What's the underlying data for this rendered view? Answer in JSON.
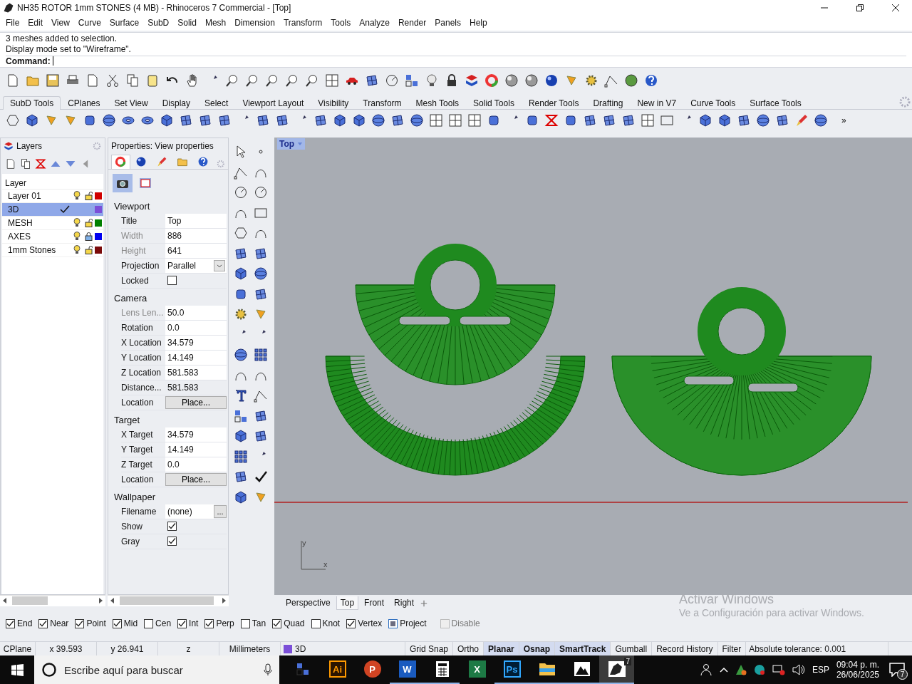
{
  "window": {
    "title": "NH35 ROTOR 1mm STONES (4 MB) - Rhinoceros 7 Commercial - [Top]"
  },
  "menu": [
    "File",
    "Edit",
    "View",
    "Curve",
    "Surface",
    "SubD",
    "Solid",
    "Mesh",
    "Dimension",
    "Transform",
    "Tools",
    "Analyze",
    "Render",
    "Panels",
    "Help"
  ],
  "command": {
    "history": [
      "3 meshes added to selection.",
      "Display mode set to \"Wireframe\"."
    ],
    "prompt": "Command:"
  },
  "toolbar_tabs": [
    {
      "label": "SubD Tools",
      "selected": true
    },
    {
      "label": "CPlanes",
      "selected": false
    },
    {
      "label": "Set View",
      "selected": false
    },
    {
      "label": "Display",
      "selected": false
    },
    {
      "label": "Select",
      "selected": false
    },
    {
      "label": "Viewport Layout",
      "selected": false
    },
    {
      "label": "Visibility",
      "selected": false
    },
    {
      "label": "Transform",
      "selected": false
    },
    {
      "label": "Mesh Tools",
      "selected": false
    },
    {
      "label": "Solid Tools",
      "selected": false
    },
    {
      "label": "Render Tools",
      "selected": false
    },
    {
      "label": "Drafting",
      "selected": false
    },
    {
      "label": "New in V7",
      "selected": false
    },
    {
      "label": "Curve Tools",
      "selected": false
    },
    {
      "label": "Surface Tools",
      "selected": false
    }
  ],
  "toolbar_more": "»",
  "layers": {
    "title": "Layers",
    "column": "Layer",
    "rows": [
      {
        "name": "Layer 01",
        "selected": false,
        "current": false,
        "visible": true,
        "locked": false,
        "color": "#d00000"
      },
      {
        "name": "3D",
        "selected": true,
        "current": true,
        "color": "#7b4fd8"
      },
      {
        "name": "MESH",
        "selected": false,
        "current": false,
        "visible": true,
        "locked": false,
        "color": "#008000"
      },
      {
        "name": "AXES",
        "selected": false,
        "current": false,
        "visible": true,
        "locked": true,
        "color": "#0000f0"
      },
      {
        "name": "1mm Stones",
        "selected": false,
        "current": false,
        "visible": true,
        "locked": false,
        "color": "#7a0a0a"
      }
    ]
  },
  "properties": {
    "title": "Properties: View properties",
    "tabs": [
      {
        "kind": "material",
        "selected": true
      },
      {
        "kind": "object",
        "selected": false
      },
      {
        "kind": "brush",
        "selected": false
      },
      {
        "kind": "folder",
        "selected": false
      },
      {
        "kind": "help",
        "selected": false
      }
    ],
    "subtabs": [
      {
        "kind": "camera",
        "selected": true
      },
      {
        "kind": "frame",
        "selected": false
      }
    ],
    "sections": [
      {
        "heading": "Viewport",
        "rows": [
          {
            "label": "Title",
            "value": "Top",
            "kind": "text",
            "disabled": false
          },
          {
            "label": "Width",
            "value": "886",
            "kind": "text",
            "disabled": true
          },
          {
            "label": "Height",
            "value": "641",
            "kind": "text",
            "disabled": true
          },
          {
            "label": "Projection",
            "value": "Parallel",
            "kind": "dropdown",
            "disabled": false
          },
          {
            "label": "Locked",
            "checked": false,
            "kind": "checkbox",
            "disabled": false
          }
        ]
      },
      {
        "heading": "Camera",
        "rows": [
          {
            "label": "Lens Len...",
            "value": "50.0",
            "kind": "text",
            "disabled": true
          },
          {
            "label": "Rotation",
            "value": "0.0",
            "kind": "text",
            "disabled": false
          },
          {
            "label": "X Location",
            "value": "34.579",
            "kind": "text",
            "disabled": false
          },
          {
            "label": "Y Location",
            "value": "14.149",
            "kind": "text",
            "disabled": false
          },
          {
            "label": "Z Location",
            "value": "581.583",
            "kind": "text",
            "disabled": false
          },
          {
            "label": "Distance...",
            "value": "581.583",
            "kind": "readonly",
            "disabled": false
          },
          {
            "label": "Location",
            "value": "Place...",
            "kind": "button",
            "disabled": false
          }
        ]
      },
      {
        "heading": "Target",
        "rows": [
          {
            "label": "X Target",
            "value": "34.579",
            "kind": "text",
            "disabled": false
          },
          {
            "label": "Y Target",
            "value": "14.149",
            "kind": "text",
            "disabled": false
          },
          {
            "label": "Z Target",
            "value": "0.0",
            "kind": "text",
            "disabled": false
          },
          {
            "label": "Location",
            "value": "Place...",
            "kind": "button",
            "disabled": false
          }
        ]
      },
      {
        "heading": "Wallpaper",
        "rows": [
          {
            "label": "Filename",
            "value": "(none)",
            "button": "...",
            "kind": "file",
            "disabled": false
          },
          {
            "label": "Show",
            "checked": true,
            "kind": "checkbox",
            "disabled": false
          },
          {
            "label": "Gray",
            "checked": true,
            "kind": "checkbox",
            "disabled": false
          }
        ]
      }
    ]
  },
  "viewport": {
    "label": "Top",
    "axis_labels": [
      "y",
      "x"
    ],
    "tabs": [
      {
        "label": "Perspective",
        "selected": false
      },
      {
        "label": "Top",
        "selected": true
      },
      {
        "label": "Front",
        "selected": false
      },
      {
        "label": "Right",
        "selected": false
      }
    ]
  },
  "activation": {
    "title": "Activar Windows",
    "text": "Ve a Configuración para activar Windows."
  },
  "osnaps": [
    {
      "label": "End",
      "checked": true,
      "kind": "check",
      "disabled": false
    },
    {
      "label": "Near",
      "checked": true,
      "kind": "check",
      "disabled": false
    },
    {
      "label": "Point",
      "checked": true,
      "kind": "check",
      "disabled": false
    },
    {
      "label": "Mid",
      "checked": true,
      "kind": "check",
      "disabled": false
    },
    {
      "label": "Cen",
      "checked": false,
      "kind": "check",
      "disabled": false
    },
    {
      "label": "Int",
      "checked": true,
      "kind": "check",
      "disabled": false
    },
    {
      "label": "Perp",
      "checked": true,
      "kind": "check",
      "disabled": false
    },
    {
      "label": "Tan",
      "checked": false,
      "kind": "check",
      "disabled": false
    },
    {
      "label": "Quad",
      "checked": true,
      "kind": "check",
      "disabled": false
    },
    {
      "label": "Knot",
      "checked": false,
      "kind": "check",
      "disabled": false
    },
    {
      "label": "Vertex",
      "checked": true,
      "kind": "check",
      "disabled": false
    },
    {
      "label": "Project",
      "checked": true,
      "kind": "square",
      "disabled": false
    },
    {
      "label": "Disable",
      "checked": false,
      "kind": "check",
      "disabled": true
    }
  ],
  "status": {
    "cells": [
      {
        "text": "CPlane",
        "kind": "text"
      },
      {
        "text": "x 39.593",
        "kind": "text"
      },
      {
        "text": "y 26.941",
        "kind": "text"
      },
      {
        "text": "z",
        "kind": "text"
      },
      {
        "text": "Millimeters",
        "kind": "text"
      },
      {
        "text": "3D",
        "kind": "layer",
        "color": "#7b4fd8"
      }
    ],
    "toggles": [
      {
        "label": "Grid Snap",
        "on": false
      },
      {
        "label": "Ortho",
        "on": false
      },
      {
        "label": "Planar",
        "on": true
      },
      {
        "label": "Osnap",
        "on": true
      },
      {
        "label": "SmartTrack",
        "on": true
      },
      {
        "label": "Gumball",
        "on": false
      },
      {
        "label": "Record History",
        "on": false
      },
      {
        "label": "Filter",
        "on": false
      }
    ],
    "tolerance": "Absolute tolerance: 0.001"
  },
  "taskbar": {
    "search": {
      "placeholder": "Escribe aquí para buscar"
    },
    "apps": [
      {
        "kind": "taskview",
        "running": false,
        "selected": false
      },
      {
        "kind": "ai",
        "label": "Ai",
        "running": false,
        "selected": false
      },
      {
        "kind": "ppt",
        "label": "P",
        "running": false,
        "selected": false
      },
      {
        "kind": "word",
        "label": "W",
        "running": true,
        "selected": false
      },
      {
        "kind": "calc",
        "running": true,
        "selected": false
      },
      {
        "kind": "excel",
        "label": "X",
        "running": false,
        "selected": false
      },
      {
        "kind": "ps",
        "label": "Ps",
        "running": true,
        "selected": false
      },
      {
        "kind": "folder",
        "running": true,
        "selected": false
      },
      {
        "kind": "photos",
        "running": true,
        "selected": false
      },
      {
        "kind": "rhino",
        "label": "7",
        "running": true,
        "selected": true
      }
    ],
    "language": "ESP",
    "time": "09:04 p. m.",
    "date": "26/06/2025",
    "notifications": "7"
  }
}
